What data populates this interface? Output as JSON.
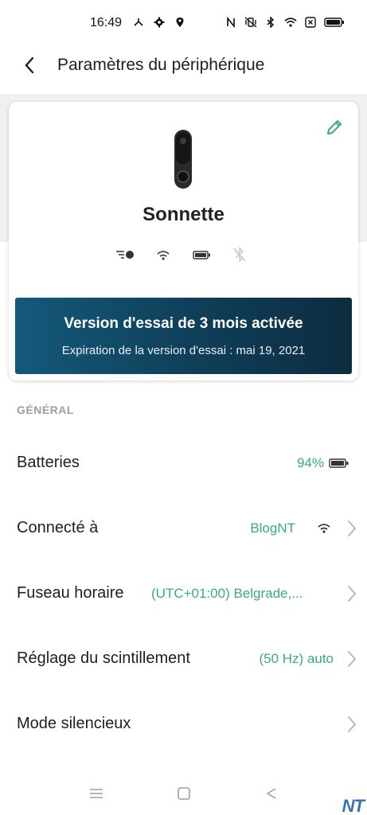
{
  "status_bar": {
    "time": "16:49",
    "left_icons": [
      "route-icon",
      "gear-icon",
      "location-icon"
    ],
    "right_icons": [
      "nfc-icon",
      "vibrate-icon",
      "bluetooth-icon",
      "wifi-icon",
      "sim-icon",
      "battery-icon"
    ]
  },
  "header": {
    "title": "Paramètres du périphérique",
    "back_icon": "chevron-left-icon"
  },
  "device": {
    "name": "Sonnette",
    "edit_icon": "pencil-icon",
    "status_icons": [
      "motion-icon",
      "wifi-icon",
      "battery-icon",
      "bluetooth-muted-icon"
    ]
  },
  "trial": {
    "title": "Version d'essai de 3 mois activée",
    "subtitle": "Expiration de la version d'essai : mai 19, 2021"
  },
  "section": {
    "title": "GÉNÉRAL"
  },
  "settings": [
    {
      "label": "Batteries",
      "value": "94%",
      "icon": "battery-icon"
    },
    {
      "label": "Connecté à",
      "value": "BlogNT",
      "icon": "wifi-icon"
    },
    {
      "label": "Fuseau horaire",
      "value": "(UTC+01:00) Belgrade,..."
    },
    {
      "label": "Réglage du scintillement",
      "value": "(50 Hz) auto"
    },
    {
      "label": "Mode silencieux",
      "value": ""
    }
  ],
  "nav_bar": {
    "icons": [
      "menu-icon",
      "home-icon",
      "back-triangle-icon"
    ]
  },
  "watermark": "NT",
  "colors": {
    "accent": "#3aaa86",
    "banner_start": "#14597a",
    "banner_end": "#0d2c40",
    "section_gray": "#9aa0a6"
  }
}
